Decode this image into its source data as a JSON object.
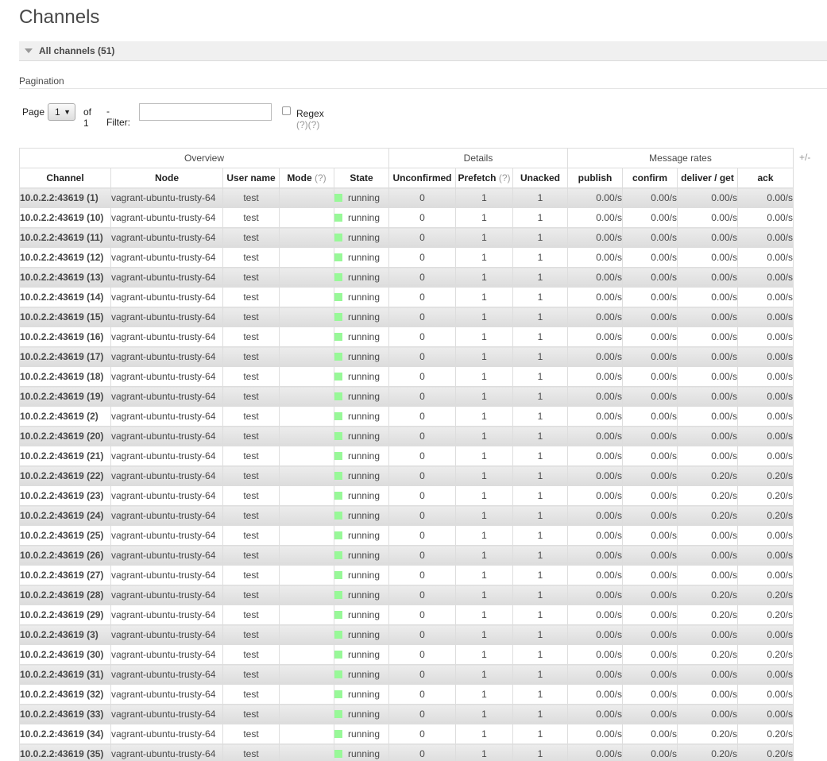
{
  "page": {
    "title": "Channels"
  },
  "section": {
    "label": "All channels (51)"
  },
  "pagination": {
    "label": "Pagination",
    "page_text": "Page",
    "page_value": "1",
    "of_text": "of 1",
    "filter_text": "- Filter:",
    "filter_value": "",
    "regex_text": "Regex",
    "regex_checked": false,
    "help": "(?)(?)"
  },
  "table": {
    "plus_minus": "+/-",
    "groups": [
      "Overview",
      "Details",
      "Message rates"
    ],
    "columns": [
      {
        "label": "Channel",
        "help": ""
      },
      {
        "label": "Node",
        "help": ""
      },
      {
        "label": "User name",
        "help": ""
      },
      {
        "label": "Mode",
        "help": "(?)"
      },
      {
        "label": "State",
        "help": ""
      },
      {
        "label": "Unconfirmed",
        "help": ""
      },
      {
        "label": "Prefetch",
        "help": "(?)"
      },
      {
        "label": "Unacked",
        "help": ""
      },
      {
        "label": "publish",
        "help": ""
      },
      {
        "label": "confirm",
        "help": ""
      },
      {
        "label": "deliver / get",
        "help": ""
      },
      {
        "label": "ack",
        "help": ""
      }
    ],
    "state_color": "#98f898",
    "rows": [
      {
        "channel": "10.0.2.2:43619 (1)",
        "node": "vagrant-ubuntu-trusty-64",
        "user": "test",
        "mode": "",
        "state": "running",
        "unconfirmed": "0",
        "prefetch": "1",
        "unacked": "1",
        "publish": "0.00/s",
        "confirm": "0.00/s",
        "deliver": "0.00/s",
        "ack": "0.00/s"
      },
      {
        "channel": "10.0.2.2:43619 (10)",
        "node": "vagrant-ubuntu-trusty-64",
        "user": "test",
        "mode": "",
        "state": "running",
        "unconfirmed": "0",
        "prefetch": "1",
        "unacked": "1",
        "publish": "0.00/s",
        "confirm": "0.00/s",
        "deliver": "0.00/s",
        "ack": "0.00/s"
      },
      {
        "channel": "10.0.2.2:43619 (11)",
        "node": "vagrant-ubuntu-trusty-64",
        "user": "test",
        "mode": "",
        "state": "running",
        "unconfirmed": "0",
        "prefetch": "1",
        "unacked": "1",
        "publish": "0.00/s",
        "confirm": "0.00/s",
        "deliver": "0.00/s",
        "ack": "0.00/s"
      },
      {
        "channel": "10.0.2.2:43619 (12)",
        "node": "vagrant-ubuntu-trusty-64",
        "user": "test",
        "mode": "",
        "state": "running",
        "unconfirmed": "0",
        "prefetch": "1",
        "unacked": "1",
        "publish": "0.00/s",
        "confirm": "0.00/s",
        "deliver": "0.00/s",
        "ack": "0.00/s"
      },
      {
        "channel": "10.0.2.2:43619 (13)",
        "node": "vagrant-ubuntu-trusty-64",
        "user": "test",
        "mode": "",
        "state": "running",
        "unconfirmed": "0",
        "prefetch": "1",
        "unacked": "1",
        "publish": "0.00/s",
        "confirm": "0.00/s",
        "deliver": "0.00/s",
        "ack": "0.00/s"
      },
      {
        "channel": "10.0.2.2:43619 (14)",
        "node": "vagrant-ubuntu-trusty-64",
        "user": "test",
        "mode": "",
        "state": "running",
        "unconfirmed": "0",
        "prefetch": "1",
        "unacked": "1",
        "publish": "0.00/s",
        "confirm": "0.00/s",
        "deliver": "0.00/s",
        "ack": "0.00/s"
      },
      {
        "channel": "10.0.2.2:43619 (15)",
        "node": "vagrant-ubuntu-trusty-64",
        "user": "test",
        "mode": "",
        "state": "running",
        "unconfirmed": "0",
        "prefetch": "1",
        "unacked": "1",
        "publish": "0.00/s",
        "confirm": "0.00/s",
        "deliver": "0.00/s",
        "ack": "0.00/s"
      },
      {
        "channel": "10.0.2.2:43619 (16)",
        "node": "vagrant-ubuntu-trusty-64",
        "user": "test",
        "mode": "",
        "state": "running",
        "unconfirmed": "0",
        "prefetch": "1",
        "unacked": "1",
        "publish": "0.00/s",
        "confirm": "0.00/s",
        "deliver": "0.00/s",
        "ack": "0.00/s"
      },
      {
        "channel": "10.0.2.2:43619 (17)",
        "node": "vagrant-ubuntu-trusty-64",
        "user": "test",
        "mode": "",
        "state": "running",
        "unconfirmed": "0",
        "prefetch": "1",
        "unacked": "1",
        "publish": "0.00/s",
        "confirm": "0.00/s",
        "deliver": "0.00/s",
        "ack": "0.00/s"
      },
      {
        "channel": "10.0.2.2:43619 (18)",
        "node": "vagrant-ubuntu-trusty-64",
        "user": "test",
        "mode": "",
        "state": "running",
        "unconfirmed": "0",
        "prefetch": "1",
        "unacked": "1",
        "publish": "0.00/s",
        "confirm": "0.00/s",
        "deliver": "0.00/s",
        "ack": "0.00/s"
      },
      {
        "channel": "10.0.2.2:43619 (19)",
        "node": "vagrant-ubuntu-trusty-64",
        "user": "test",
        "mode": "",
        "state": "running",
        "unconfirmed": "0",
        "prefetch": "1",
        "unacked": "1",
        "publish": "0.00/s",
        "confirm": "0.00/s",
        "deliver": "0.00/s",
        "ack": "0.00/s"
      },
      {
        "channel": "10.0.2.2:43619 (2)",
        "node": "vagrant-ubuntu-trusty-64",
        "user": "test",
        "mode": "",
        "state": "running",
        "unconfirmed": "0",
        "prefetch": "1",
        "unacked": "1",
        "publish": "0.00/s",
        "confirm": "0.00/s",
        "deliver": "0.00/s",
        "ack": "0.00/s"
      },
      {
        "channel": "10.0.2.2:43619 (20)",
        "node": "vagrant-ubuntu-trusty-64",
        "user": "test",
        "mode": "",
        "state": "running",
        "unconfirmed": "0",
        "prefetch": "1",
        "unacked": "1",
        "publish": "0.00/s",
        "confirm": "0.00/s",
        "deliver": "0.00/s",
        "ack": "0.00/s"
      },
      {
        "channel": "10.0.2.2:43619 (21)",
        "node": "vagrant-ubuntu-trusty-64",
        "user": "test",
        "mode": "",
        "state": "running",
        "unconfirmed": "0",
        "prefetch": "1",
        "unacked": "1",
        "publish": "0.00/s",
        "confirm": "0.00/s",
        "deliver": "0.00/s",
        "ack": "0.00/s"
      },
      {
        "channel": "10.0.2.2:43619 (22)",
        "node": "vagrant-ubuntu-trusty-64",
        "user": "test",
        "mode": "",
        "state": "running",
        "unconfirmed": "0",
        "prefetch": "1",
        "unacked": "1",
        "publish": "0.00/s",
        "confirm": "0.00/s",
        "deliver": "0.20/s",
        "ack": "0.20/s"
      },
      {
        "channel": "10.0.2.2:43619 (23)",
        "node": "vagrant-ubuntu-trusty-64",
        "user": "test",
        "mode": "",
        "state": "running",
        "unconfirmed": "0",
        "prefetch": "1",
        "unacked": "1",
        "publish": "0.00/s",
        "confirm": "0.00/s",
        "deliver": "0.20/s",
        "ack": "0.20/s"
      },
      {
        "channel": "10.0.2.2:43619 (24)",
        "node": "vagrant-ubuntu-trusty-64",
        "user": "test",
        "mode": "",
        "state": "running",
        "unconfirmed": "0",
        "prefetch": "1",
        "unacked": "1",
        "publish": "0.00/s",
        "confirm": "0.00/s",
        "deliver": "0.20/s",
        "ack": "0.20/s"
      },
      {
        "channel": "10.0.2.2:43619 (25)",
        "node": "vagrant-ubuntu-trusty-64",
        "user": "test",
        "mode": "",
        "state": "running",
        "unconfirmed": "0",
        "prefetch": "1",
        "unacked": "1",
        "publish": "0.00/s",
        "confirm": "0.00/s",
        "deliver": "0.00/s",
        "ack": "0.00/s"
      },
      {
        "channel": "10.0.2.2:43619 (26)",
        "node": "vagrant-ubuntu-trusty-64",
        "user": "test",
        "mode": "",
        "state": "running",
        "unconfirmed": "0",
        "prefetch": "1",
        "unacked": "1",
        "publish": "0.00/s",
        "confirm": "0.00/s",
        "deliver": "0.00/s",
        "ack": "0.00/s"
      },
      {
        "channel": "10.0.2.2:43619 (27)",
        "node": "vagrant-ubuntu-trusty-64",
        "user": "test",
        "mode": "",
        "state": "running",
        "unconfirmed": "0",
        "prefetch": "1",
        "unacked": "1",
        "publish": "0.00/s",
        "confirm": "0.00/s",
        "deliver": "0.00/s",
        "ack": "0.00/s"
      },
      {
        "channel": "10.0.2.2:43619 (28)",
        "node": "vagrant-ubuntu-trusty-64",
        "user": "test",
        "mode": "",
        "state": "running",
        "unconfirmed": "0",
        "prefetch": "1",
        "unacked": "1",
        "publish": "0.00/s",
        "confirm": "0.00/s",
        "deliver": "0.20/s",
        "ack": "0.20/s"
      },
      {
        "channel": "10.0.2.2:43619 (29)",
        "node": "vagrant-ubuntu-trusty-64",
        "user": "test",
        "mode": "",
        "state": "running",
        "unconfirmed": "0",
        "prefetch": "1",
        "unacked": "1",
        "publish": "0.00/s",
        "confirm": "0.00/s",
        "deliver": "0.20/s",
        "ack": "0.20/s"
      },
      {
        "channel": "10.0.2.2:43619 (3)",
        "node": "vagrant-ubuntu-trusty-64",
        "user": "test",
        "mode": "",
        "state": "running",
        "unconfirmed": "0",
        "prefetch": "1",
        "unacked": "1",
        "publish": "0.00/s",
        "confirm": "0.00/s",
        "deliver": "0.00/s",
        "ack": "0.00/s"
      },
      {
        "channel": "10.0.2.2:43619 (30)",
        "node": "vagrant-ubuntu-trusty-64",
        "user": "test",
        "mode": "",
        "state": "running",
        "unconfirmed": "0",
        "prefetch": "1",
        "unacked": "1",
        "publish": "0.00/s",
        "confirm": "0.00/s",
        "deliver": "0.20/s",
        "ack": "0.20/s"
      },
      {
        "channel": "10.0.2.2:43619 (31)",
        "node": "vagrant-ubuntu-trusty-64",
        "user": "test",
        "mode": "",
        "state": "running",
        "unconfirmed": "0",
        "prefetch": "1",
        "unacked": "1",
        "publish": "0.00/s",
        "confirm": "0.00/s",
        "deliver": "0.00/s",
        "ack": "0.00/s"
      },
      {
        "channel": "10.0.2.2:43619 (32)",
        "node": "vagrant-ubuntu-trusty-64",
        "user": "test",
        "mode": "",
        "state": "running",
        "unconfirmed": "0",
        "prefetch": "1",
        "unacked": "1",
        "publish": "0.00/s",
        "confirm": "0.00/s",
        "deliver": "0.00/s",
        "ack": "0.00/s"
      },
      {
        "channel": "10.0.2.2:43619 (33)",
        "node": "vagrant-ubuntu-trusty-64",
        "user": "test",
        "mode": "",
        "state": "running",
        "unconfirmed": "0",
        "prefetch": "1",
        "unacked": "1",
        "publish": "0.00/s",
        "confirm": "0.00/s",
        "deliver": "0.00/s",
        "ack": "0.00/s"
      },
      {
        "channel": "10.0.2.2:43619 (34)",
        "node": "vagrant-ubuntu-trusty-64",
        "user": "test",
        "mode": "",
        "state": "running",
        "unconfirmed": "0",
        "prefetch": "1",
        "unacked": "1",
        "publish": "0.00/s",
        "confirm": "0.00/s",
        "deliver": "0.20/s",
        "ack": "0.20/s"
      },
      {
        "channel": "10.0.2.2:43619 (35)",
        "node": "vagrant-ubuntu-trusty-64",
        "user": "test",
        "mode": "",
        "state": "running",
        "unconfirmed": "0",
        "prefetch": "1",
        "unacked": "1",
        "publish": "0.00/s",
        "confirm": "0.00/s",
        "deliver": "0.20/s",
        "ack": "0.20/s"
      }
    ]
  }
}
